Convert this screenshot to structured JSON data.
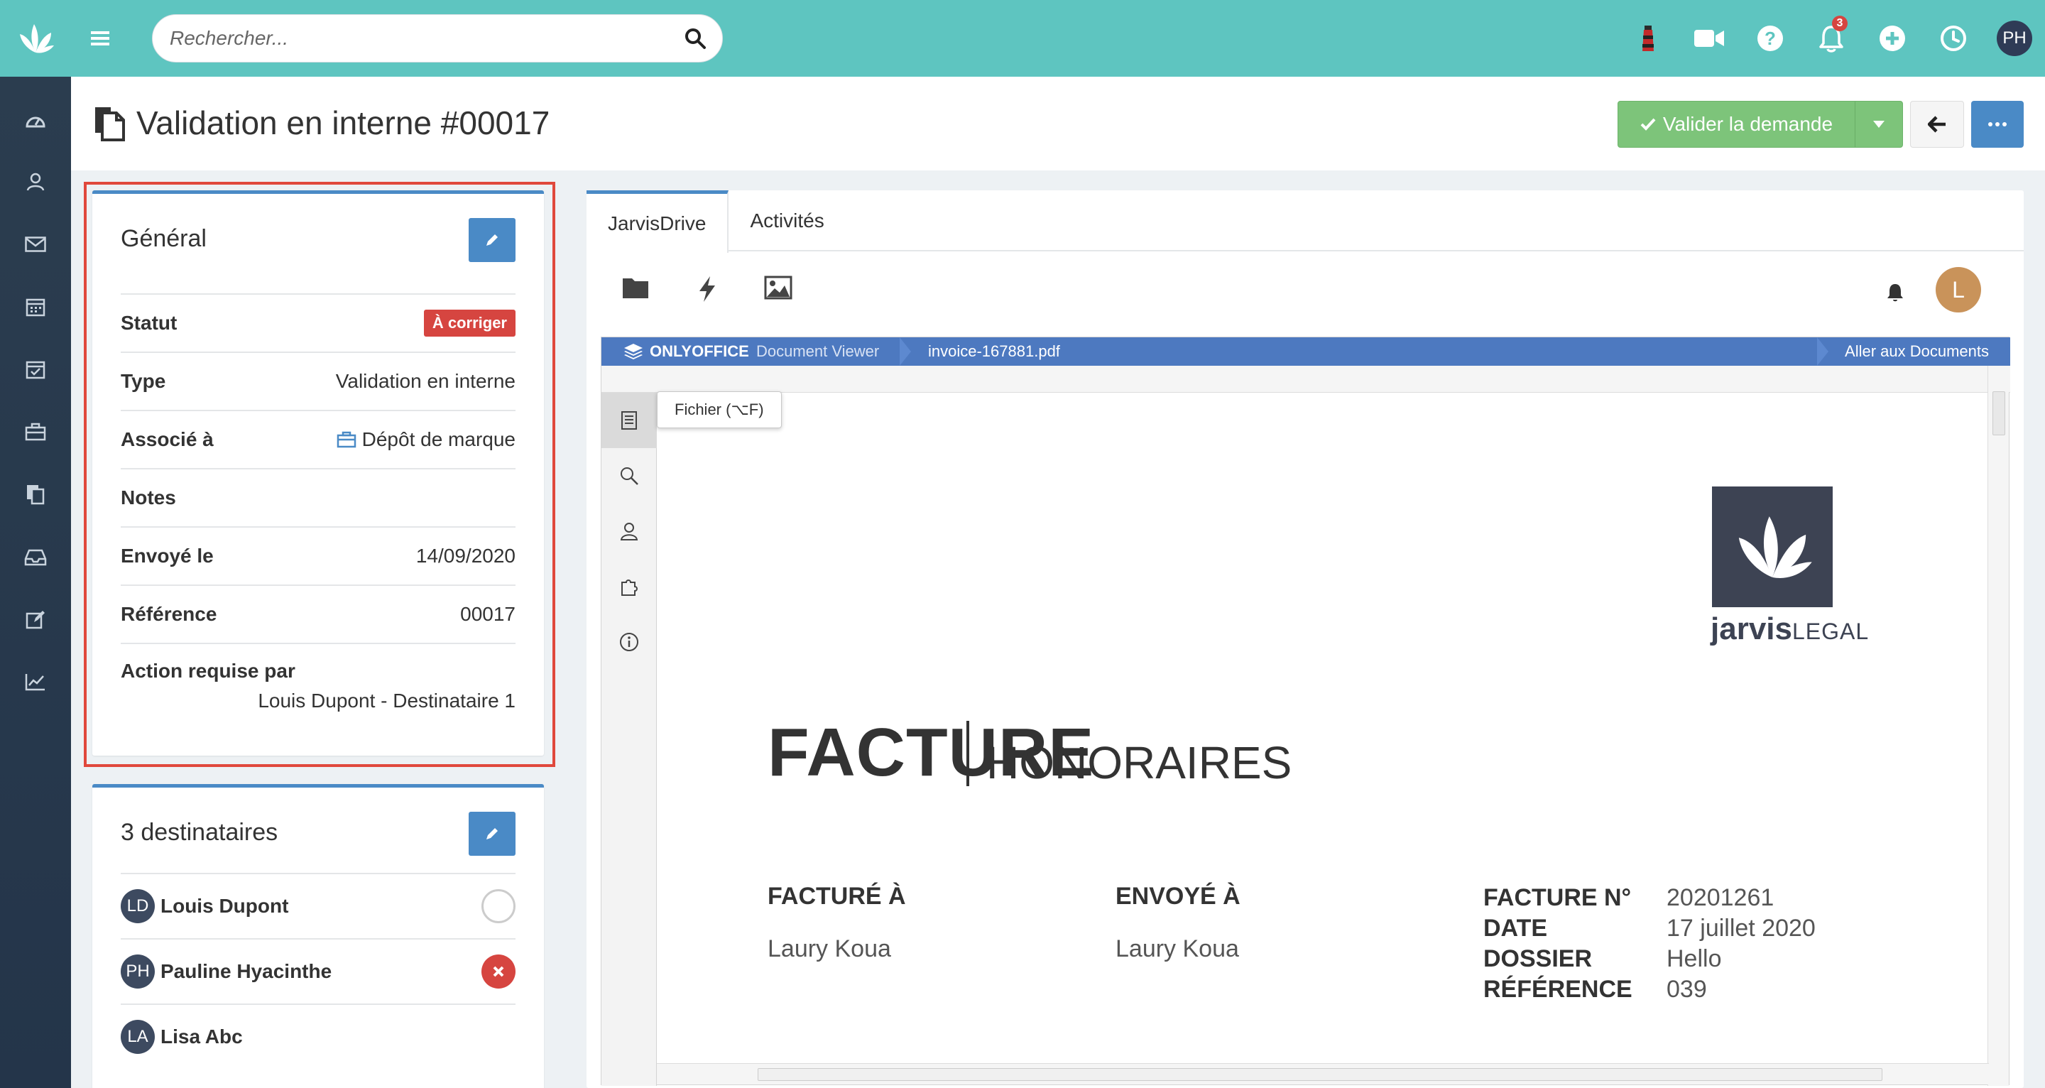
{
  "topbar": {
    "search_placeholder": "Rechercher...",
    "notification_count": "3",
    "user_initials": "PH",
    "icons": [
      "lighthouse-icon",
      "video-icon",
      "help-icon",
      "bell-icon",
      "plus-circle-icon",
      "clock-icon"
    ]
  },
  "sidebar": {
    "items": [
      "dashboard-icon",
      "contacts-icon",
      "mail-icon",
      "calendar-icon",
      "calendar-check-icon",
      "briefcase-icon",
      "documents-icon",
      "inbox-icon",
      "edit-icon",
      "chart-icon"
    ]
  },
  "header": {
    "title": "Validation en interne #00017",
    "validate_label": "Valider la demande"
  },
  "general": {
    "title": "Général",
    "rows": {
      "statut_label": "Statut",
      "statut_value": "À corriger",
      "type_label": "Type",
      "type_value": "Validation en interne",
      "associe_label": "Associé à",
      "associe_value": "Dépôt de marque",
      "notes_label": "Notes",
      "envoye_label": "Envoyé le",
      "envoye_value": "14/09/2020",
      "reference_label": "Référence",
      "reference_value": "00017",
      "action_label": "Action requise par",
      "action_value": "Louis Dupont - Destinataire 1"
    }
  },
  "recipients": {
    "title": "3 destinataires",
    "items": [
      {
        "initials": "LD",
        "name": "Louis Dupont",
        "status": "pending"
      },
      {
        "initials": "PH",
        "name": "Pauline Hyacinthe",
        "status": "rejected"
      },
      {
        "initials": "LA",
        "name": "Lisa Abc",
        "status": "none"
      }
    ]
  },
  "panel": {
    "tabs": [
      "JarvisDrive",
      "Activités"
    ],
    "active_tab": "JarvisDrive",
    "user_initial": "L"
  },
  "viewer": {
    "brand": "ONLYOFFICE",
    "subtitle": "Document Viewer",
    "filename": "invoice-167881.pdf",
    "goto_label": "Aller aux Documents",
    "tooltip": "Fichier (⌥F)"
  },
  "document": {
    "logo_word_bold": "jarvis",
    "logo_word_light": "LEGAL",
    "title": "FACTURE",
    "subtitle": "HONORAIRES",
    "billed_to_label": "FACTURÉ À",
    "billed_to_value": "Laury Koua",
    "sent_to_label": "ENVOYÉ À",
    "sent_to_value": "Laury Koua",
    "meta": [
      {
        "key": "FACTURE N°",
        "value": "20201261"
      },
      {
        "key": "DATE",
        "value": "17 juillet 2020"
      },
      {
        "key": "DOSSIER",
        "value": "Hello"
      },
      {
        "key": "RÉFÉRENCE",
        "value": "039"
      }
    ]
  },
  "colors": {
    "topbar": "#5ec5c0",
    "sidebar": "#2b3d4f",
    "accent": "#4a8ac6",
    "success": "#7dc47a",
    "danger": "#d64540",
    "onlyoffice": "#4d79c0"
  }
}
